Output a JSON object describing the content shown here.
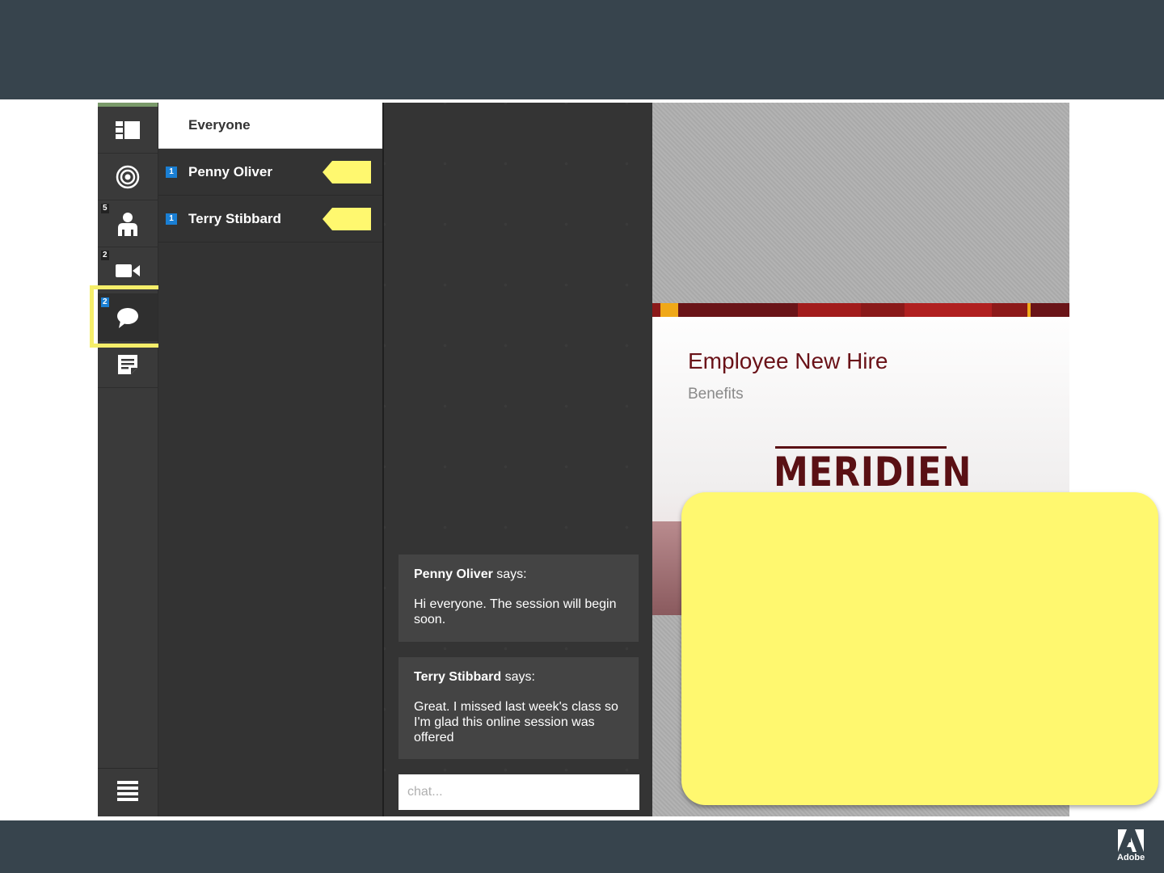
{
  "rail": {
    "badges": {
      "attendees": "5",
      "cameras": "2",
      "chat": "2"
    }
  },
  "userlist": {
    "header": "Everyone",
    "users": [
      {
        "name": "Penny Oliver",
        "count": "1"
      },
      {
        "name": "Terry Stibbard",
        "count": "1"
      }
    ]
  },
  "chat": {
    "messages": [
      {
        "sender": "Penny Oliver",
        "verb": "says:",
        "text": "Hi everyone. The session will begin soon."
      },
      {
        "sender": "Terry Stibbard",
        "verb": "says:",
        "text": "Great. I missed last week's class so I'm glad this online session was offered"
      }
    ],
    "input_placeholder": "chat..."
  },
  "slide": {
    "title": "Employee New Hire",
    "subtitle": "Benefits",
    "logo": "MERIDIEN"
  },
  "footer": {
    "brand": "Adobe"
  },
  "colors": {
    "highlight": "#f5ee6a",
    "note": "#fff86f",
    "badge_blue": "#1a7fd4",
    "brand_maroon": "#6a1218",
    "chrome": "#37444d"
  }
}
